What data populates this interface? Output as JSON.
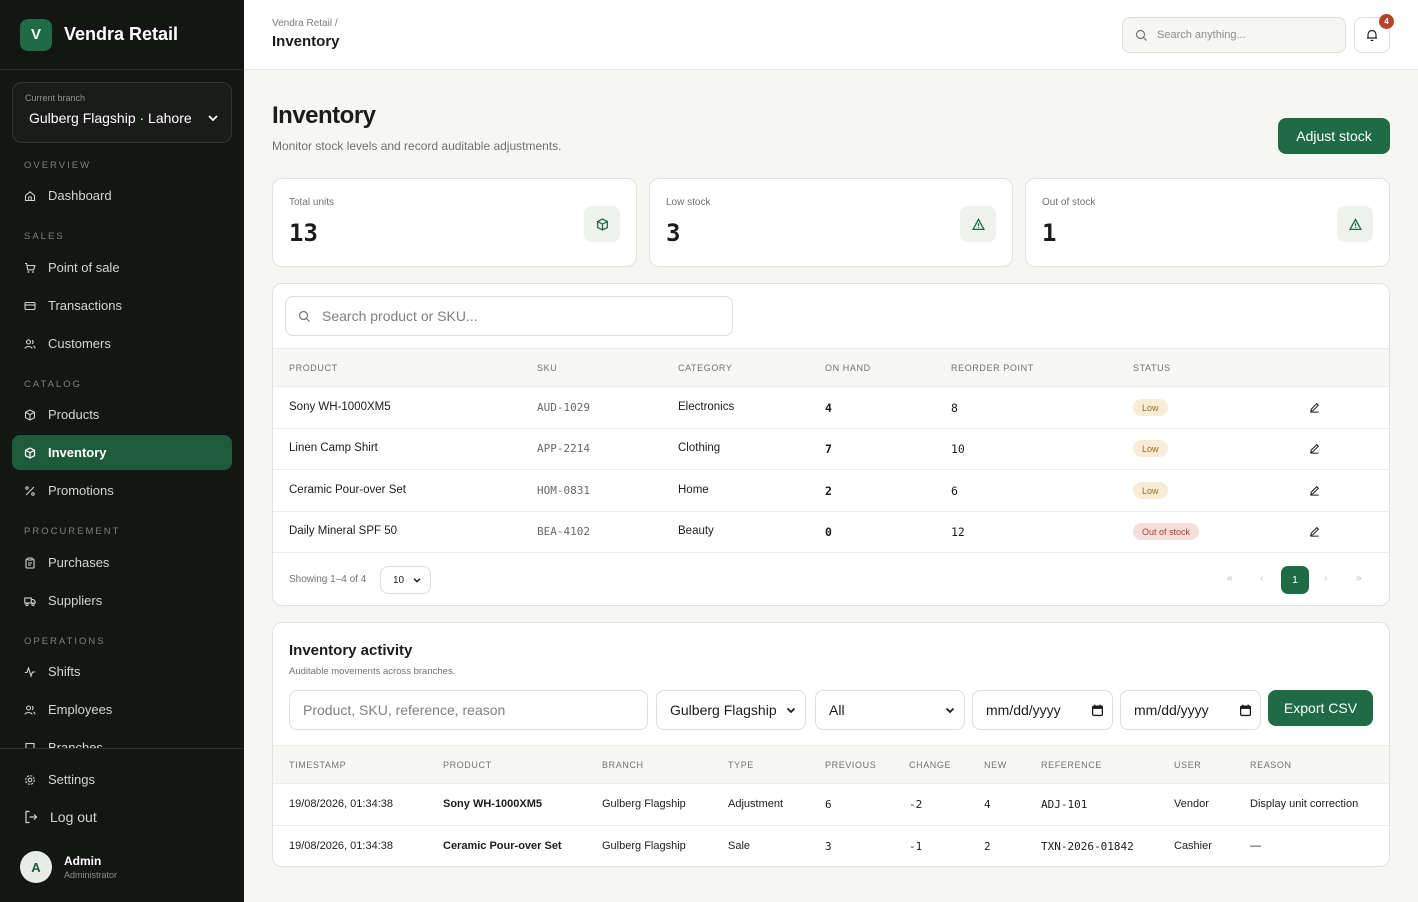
{
  "brand": {
    "logo_letter": "V",
    "name": "Vendra Retail"
  },
  "branch": {
    "caption": "Current branch",
    "value": "Gulberg Flagship · Lahore"
  },
  "nav": {
    "sections": {
      "overview": "OVERVIEW",
      "sales": "SALES",
      "catalog": "CATALOG",
      "procurement": "PROCUREMENT",
      "operations": "OPERATIONS"
    },
    "items": {
      "dashboard": "Dashboard",
      "pos": "Point of sale",
      "transactions": "Transactions",
      "customers": "Customers",
      "products": "Products",
      "inventory": "Inventory",
      "promotions": "Promotions",
      "purchases": "Purchases",
      "suppliers": "Suppliers",
      "shifts": "Shifts",
      "employees": "Employees",
      "branches": "Branches"
    },
    "settings": "Settings",
    "logout": "Log out"
  },
  "user": {
    "initial": "A",
    "name": "Admin",
    "role": "Administrator"
  },
  "topbar": {
    "breadcrumb": "Vendra Retail /",
    "title": "Inventory",
    "search_placeholder": "Search anything...",
    "notifications": "4"
  },
  "page": {
    "title": "Inventory",
    "subtitle": "Monitor stock levels and record auditable adjustments.",
    "adjust_button": "Adjust stock"
  },
  "stats": [
    {
      "label": "Total units",
      "value": "13"
    },
    {
      "label": "Low stock",
      "value": "3"
    },
    {
      "label": "Out of stock",
      "value": "1"
    }
  ],
  "stock_table": {
    "search_placeholder": "Search product or SKU...",
    "headers": {
      "product": "PRODUCT",
      "sku": "SKU",
      "category": "CATEGORY",
      "on_hand": "ON HAND",
      "reorder": "REORDER POINT",
      "status": "STATUS"
    },
    "rows": [
      {
        "product": "Sony WH-1000XM5",
        "sku": "AUD-1029",
        "category": "Electronics",
        "on_hand": "4",
        "reorder": "8",
        "status": "Low"
      },
      {
        "product": "Linen Camp Shirt",
        "sku": "APP-2214",
        "category": "Clothing",
        "on_hand": "7",
        "reorder": "10",
        "status": "Low"
      },
      {
        "product": "Ceramic Pour-over Set",
        "sku": "HOM-0831",
        "category": "Home",
        "on_hand": "2",
        "reorder": "6",
        "status": "Low"
      },
      {
        "product": "Daily Mineral SPF 50",
        "sku": "BEA-4102",
        "category": "Beauty",
        "on_hand": "0",
        "reorder": "12",
        "status": "Out of stock"
      }
    ],
    "footer": {
      "showing": "Showing 1–4 of 4",
      "page_size": "10",
      "current_page": "1",
      "first": "«",
      "prev": "‹",
      "next": "›",
      "last": "»"
    }
  },
  "activity": {
    "title": "Inventory activity",
    "subtitle": "Auditable movements across branches.",
    "filters": {
      "search_placeholder": "Product, SKU, reference, reason",
      "branch": "Gulberg Flagship",
      "type": "All",
      "date_from": "mm/dd/yyyy",
      "date_to": "mm/dd/yyyy"
    },
    "export_button": "Export CSV",
    "headers": {
      "timestamp": "TIMESTAMP",
      "product": "PRODUCT",
      "branch": "BRANCH",
      "type": "TYPE",
      "previous": "PREVIOUS",
      "change": "CHANGE",
      "new": "NEW",
      "reference": "REFERENCE",
      "user": "USER",
      "reason": "REASON"
    },
    "rows": [
      {
        "timestamp": "19/08/2026, 01:34:38",
        "product": "Sony WH-1000XM5",
        "branch": "Gulberg Flagship",
        "type": "Adjustment",
        "previous": "6",
        "change": "-2",
        "new": "4",
        "reference": "ADJ-101",
        "user": "Vendor",
        "reason": "Display unit correction"
      },
      {
        "timestamp": "19/08/2026, 01:34:38",
        "product": "Ceramic Pour-over Set",
        "branch": "Gulberg Flagship",
        "type": "Sale",
        "previous": "3",
        "change": "-1",
        "new": "2",
        "reference": "TXN-2026-01842",
        "user": "Cashier",
        "reason": "—"
      }
    ]
  }
}
